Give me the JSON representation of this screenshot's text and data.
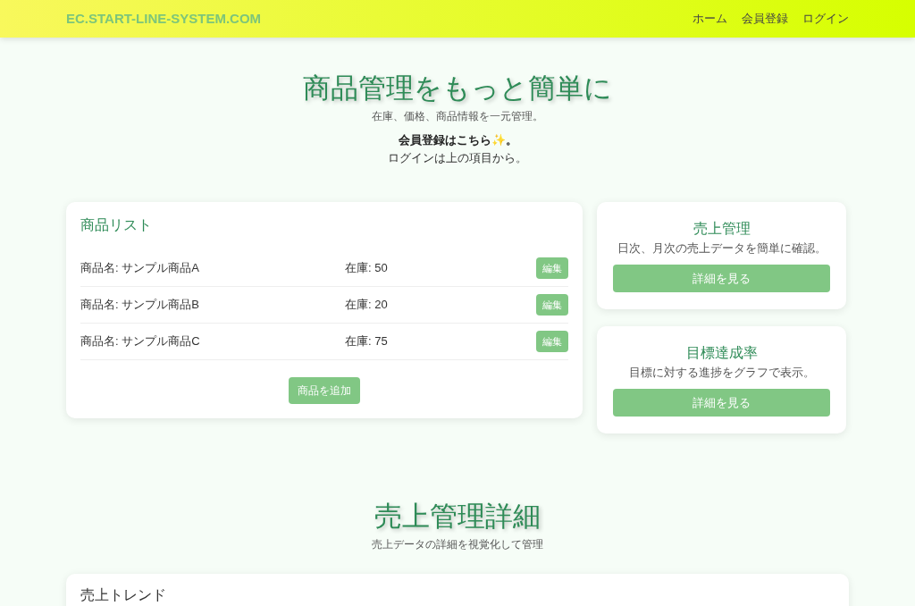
{
  "header": {
    "brand": "EC.START-LINE-SYSTEM.COM",
    "nav": [
      "ホーム",
      "会員登録",
      "ログイン"
    ]
  },
  "hero": {
    "title": "商品管理をもっと簡単に",
    "subtitle": "在庫、価格、商品情報を一元管理。",
    "signup_text": "会員登録はこちら✨。",
    "login_note": "ログインは上の項目から。"
  },
  "product_list": {
    "title": "商品リスト",
    "items": [
      {
        "name": "商品名: サンプル商品A",
        "stock": "在庫: 50",
        "button": "編集"
      },
      {
        "name": "商品名: サンプル商品B",
        "stock": "在庫: 20",
        "button": "編集"
      },
      {
        "name": "商品名: サンプル商品C",
        "stock": "在庫: 75",
        "button": "編集"
      }
    ],
    "add_button": "商品を追加"
  },
  "feature_cards": [
    {
      "title": "売上管理",
      "description": "日次、月次の売上データを簡単に確認。",
      "button": "詳細を見る"
    },
    {
      "title": "目標達成率",
      "description": "目標に対する進捗をグラフで表示。",
      "button": "詳細を見る"
    }
  ],
  "sales_section": {
    "title": "売上管理詳細",
    "subtitle": "売上データの詳細を視覚化して管理",
    "card_title": "売上トレンド"
  }
}
